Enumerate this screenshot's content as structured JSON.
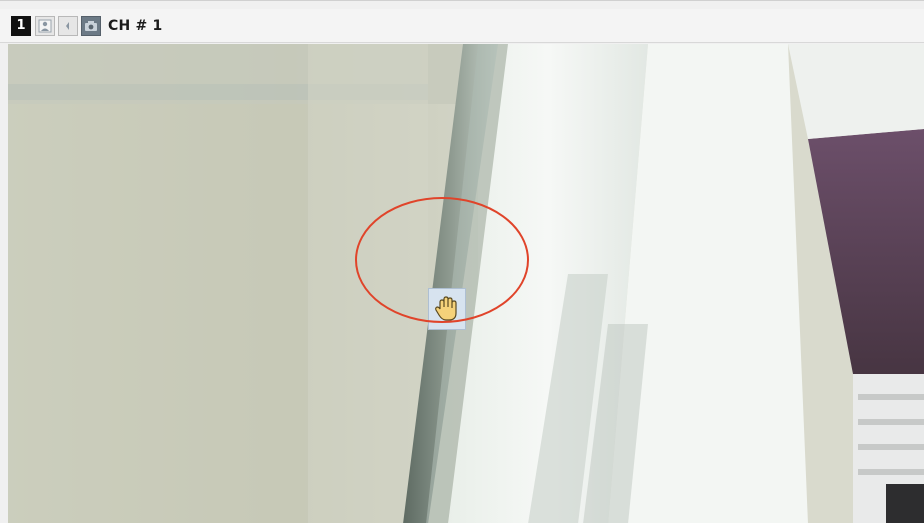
{
  "toolbar": {
    "channel_number": "1",
    "channel_title": "CH # 1",
    "icons": [
      "person-icon",
      "speaker-icon",
      "camera-icon"
    ]
  },
  "video": {
    "cursor": "hand-cursor-icon",
    "highlight_color": "#e0442a"
  }
}
